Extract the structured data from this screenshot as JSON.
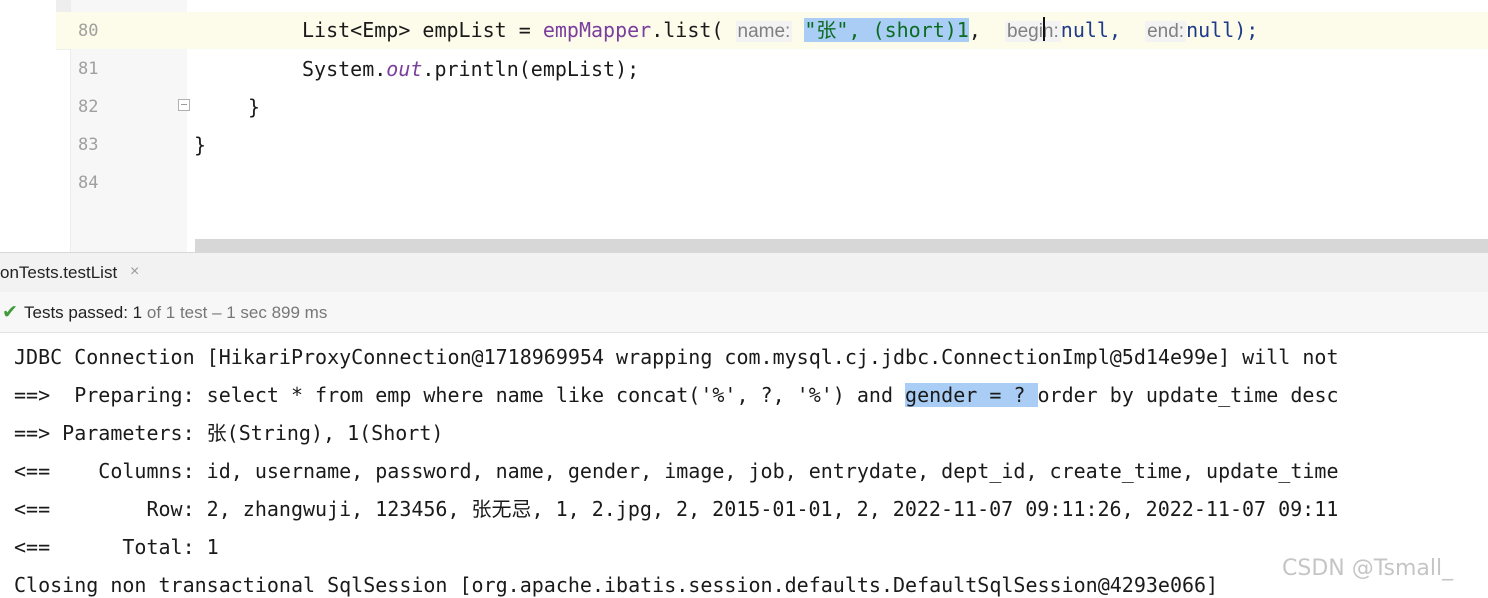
{
  "editor": {
    "line_numbers": [
      "80",
      "81",
      "82",
      "83",
      "84"
    ],
    "line80": {
      "prefix": "List<Emp> empList = ",
      "obj": "empMapper",
      "dot_list": ".list(",
      "hint_name": "name:",
      "arg_name": "\"张\", (short)1",
      "after_sel": ",",
      "hint_begin": "begin:",
      "arg_begin": "null,",
      "hint_end": "end:",
      "arg_end": "null);"
    },
    "line81": {
      "prefix": "System.",
      "field": "out",
      "suffix": ".println(empList);"
    },
    "line82": "}",
    "line83": "}"
  },
  "run_panel": {
    "tab_label": "onTests.testList",
    "tab_close": "×",
    "status_icon": "check-icon",
    "status_passed": "Tests passed: ",
    "status_count": "1",
    "status_rest": " of 1 test – 1 sec 899 ms",
    "colors": {
      "passed": "#3f9a3b",
      "selection": "#a9cdf5"
    }
  },
  "console": {
    "line1": "JDBC Connection [HikariProxyConnection@1718969954 wrapping com.mysql.cj.jdbc.ConnectionImpl@5d14e99e] will not",
    "line2_pre": "==>  Preparing: select * from emp where name like concat('%', ?, '%') and ",
    "line2_hl": "gender = ? ",
    "line2_post": "order by update_time desc",
    "line3": "==> Parameters: 张(String), 1(Short)",
    "line4": "<==    Columns: id, username, password, name, gender, image, job, entrydate, dept_id, create_time, update_time",
    "line5": "<==        Row: 2, zhangwuji, 123456, 张无忌, 1, 2.jpg, 2, 2015-01-01, 2, 2022-11-07 09:11:26, 2022-11-07 09:11",
    "line6": "<==      Total: 1",
    "line7": "Closing non transactional SqlSession [org.apache.ibatis.session.defaults.DefaultSqlSession@4293e066]"
  },
  "watermark": "CSDN @Tsmall_"
}
